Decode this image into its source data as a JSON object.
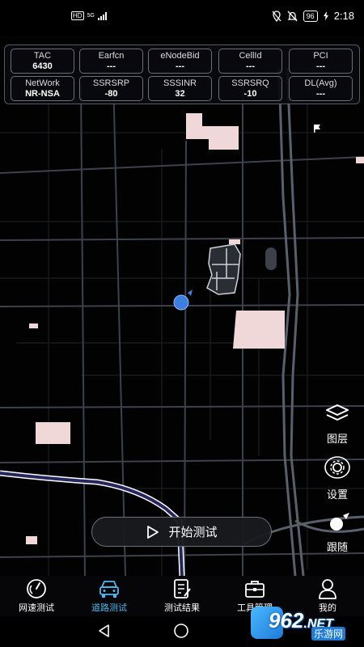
{
  "status_bar": {
    "hd": "HD",
    "network": "5G",
    "battery": "96",
    "time": "2:18"
  },
  "info_panel": {
    "row1": [
      {
        "label": "TAC",
        "value": "6430"
      },
      {
        "label": "Earfcn",
        "value": "---"
      },
      {
        "label": "eNodeBid",
        "value": "---"
      },
      {
        "label": "CellId",
        "value": "---"
      },
      {
        "label": "PCI",
        "value": "---"
      }
    ],
    "row2": [
      {
        "label": "NetWork",
        "value": "NR-NSA"
      },
      {
        "label": "SSRSRP",
        "value": "-80"
      },
      {
        "label": "SSSINR",
        "value": "32"
      },
      {
        "label": "SSRSRQ",
        "value": "-10"
      },
      {
        "label": "DL(Avg)",
        "value": "---"
      }
    ]
  },
  "map_controls": {
    "layers_label": "图层",
    "settings_label": "设置",
    "follow_label": "跟随"
  },
  "start_button_label": "开始测试",
  "bottom_nav": {
    "tabs": [
      {
        "label": "网速测试",
        "icon": "speedometer-icon",
        "active": false
      },
      {
        "label": "道路测试",
        "icon": "car-icon",
        "active": true
      },
      {
        "label": "测试结果",
        "icon": "report-icon",
        "active": false
      },
      {
        "label": "工具管理",
        "icon": "toolbox-icon",
        "active": false
      },
      {
        "label": "我的",
        "icon": "person-icon",
        "active": false
      }
    ]
  },
  "watermark": {
    "number": "962",
    "suffix": ".NET",
    "text": "乐游网"
  },
  "colors": {
    "accent": "#4fb8f0",
    "map_background": "#020203",
    "road": "#3a3f48",
    "building": "#f0d8d8",
    "route": "#2a2a66",
    "location_dot": "#3b7fe0"
  }
}
